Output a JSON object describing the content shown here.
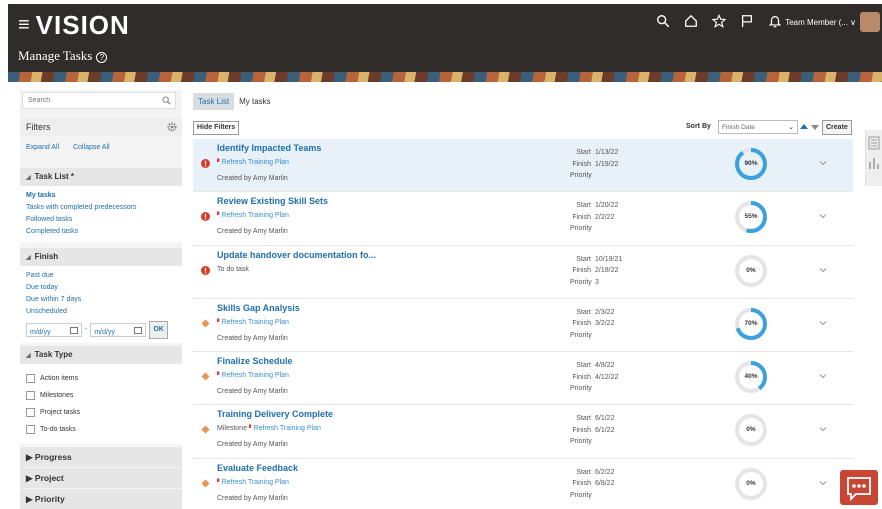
{
  "header": {
    "logo": "VISION",
    "page_title": "Manage Tasks",
    "user_label": "Team Member (... ∨"
  },
  "sidebar": {
    "search_placeholder": "Search",
    "filters_title": "Filters",
    "expand_all": "Expand All",
    "collapse_all": "Collapse All",
    "task_list": {
      "title": "Task List *",
      "items": [
        "My tasks",
        "Tasks with completed predecessors",
        "Followed tasks",
        "Completed tasks"
      ]
    },
    "finish": {
      "title": "Finish",
      "items": [
        "Past due",
        "Due today",
        "Due within 7 days",
        "Unscheduled"
      ],
      "date_placeholder_1": "m/d/yy",
      "date_separator": "-",
      "date_placeholder_2": "m/d/yy",
      "ok": "OK"
    },
    "task_type": {
      "title": "Task Type",
      "items": [
        "Action items",
        "Milestones",
        "Project tasks",
        "To-do tasks"
      ]
    },
    "collapsed_sections": [
      "Progress",
      "Project",
      "Priority"
    ]
  },
  "main": {
    "tabs": [
      "Task List",
      "My tasks"
    ],
    "hide_filters": "Hide Filters",
    "sort_by_label": "Sort By",
    "sort_value": "Finish Date",
    "create": "Create",
    "labels": {
      "start": "Start",
      "finish": "Finish",
      "priority": "Priority",
      "created_by": "Created by"
    },
    "tasks": [
      {
        "title": "Identify Impacted Teams",
        "icon": "error-icon",
        "prefix": "",
        "plan": "Refresh Training Plan",
        "created_by": "Amy Marlin",
        "start": "1/13/22",
        "finish": "1/19/22",
        "priority": "",
        "progress": 90,
        "selected": true
      },
      {
        "title": "Review Existing Skill Sets",
        "icon": "error-icon",
        "prefix": "",
        "plan": "Refresh Training Plan",
        "created_by": "Amy Marlin",
        "start": "1/20/22",
        "finish": "2/2/22",
        "priority": "",
        "progress": 55,
        "selected": false
      },
      {
        "title": "Update handover documentation fo...",
        "icon": "error-icon",
        "prefix": "To do task",
        "plan": "",
        "created_by": "",
        "start": "10/19/21",
        "finish": "2/18/22",
        "priority": "3",
        "progress": 0,
        "selected": false
      },
      {
        "title": "Skills Gap Analysis",
        "icon": "diamond-icon",
        "prefix": "",
        "plan": "Refresh Training Plan",
        "created_by": "Amy Marlin",
        "start": "2/3/22",
        "finish": "3/2/22",
        "priority": "",
        "progress": 70,
        "selected": false
      },
      {
        "title": "Finalize Schedule",
        "icon": "diamond-icon",
        "prefix": "",
        "plan": "Refresh Training Plan",
        "created_by": "Amy Marlin",
        "start": "4/8/22",
        "finish": "4/12/22",
        "priority": "",
        "progress": 40,
        "selected": false
      },
      {
        "title": "Training Delivery Complete",
        "icon": "diamond-icon",
        "prefix": "Milestone",
        "plan": "Refresh Training Plan",
        "created_by": "Amy Marlin",
        "start": "6/1/22",
        "finish": "6/1/22",
        "priority": "",
        "progress": 0,
        "selected": false
      },
      {
        "title": "Evaluate Feedback",
        "icon": "diamond-icon",
        "prefix": "",
        "plan": "Refresh Training Plan",
        "created_by": "Amy Marlin",
        "start": "6/2/22",
        "finish": "6/8/22",
        "priority": "",
        "progress": 0,
        "selected": false
      }
    ]
  },
  "colors": {
    "header_bg": "#302c2a",
    "link": "#1f6fad",
    "ring": "#3aa0de",
    "error": "#d93a2b",
    "diamond": "#e8955a",
    "chat": "#c74634"
  }
}
